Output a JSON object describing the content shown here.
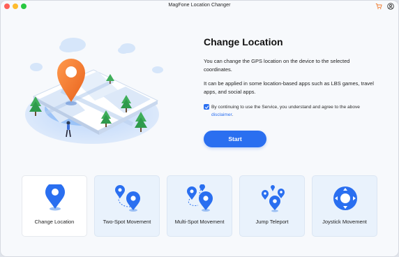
{
  "app": {
    "title": "MagFone Location Changer"
  },
  "titlebar": {
    "icons": [
      "cart-icon",
      "account-icon"
    ]
  },
  "main": {
    "heading": "Change Location",
    "description_1": "You can change the GPS location on the device to the selected coordinates.",
    "description_2": "It can be applied in some location-based apps such as LBS games, travel apps, and social apps.",
    "agreement": {
      "checked": true,
      "text": "By continuing to use the Service, you understand and agree to the above",
      "link": "disclaimer",
      "end": "."
    },
    "start_label": "Start"
  },
  "modes": [
    {
      "label": "Change Location",
      "icon": "map-pin-icon",
      "active": true
    },
    {
      "label": "Two-Spot Movement",
      "icon": "two-spot-icon",
      "active": false
    },
    {
      "label": "Multi-Spot Movement",
      "icon": "multi-spot-icon",
      "active": false
    },
    {
      "label": "Jump Teleport",
      "icon": "jump-teleport-icon",
      "active": false
    },
    {
      "label": "Joystick Movement",
      "icon": "joystick-icon",
      "active": false
    }
  ],
  "colors": {
    "accent": "#2a6ff0",
    "pin_orange": "#f07a2e",
    "window_bg": "#f7f9fc",
    "card_bg": "#e9f2fc"
  }
}
